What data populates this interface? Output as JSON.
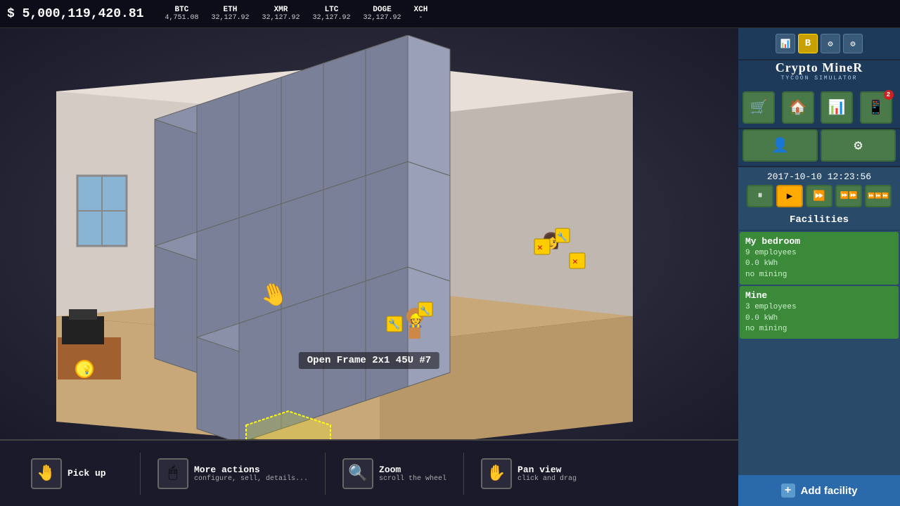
{
  "top_bar": {
    "balance": "$ 5,000,119,420.81",
    "cryptos": [
      {
        "name": "BTC",
        "value": "4,751.08"
      },
      {
        "name": "ETH",
        "value": "32,127.92"
      },
      {
        "name": "XMR",
        "value": "32,127.92"
      },
      {
        "name": "LTC",
        "value": "32,127.92"
      },
      {
        "name": "DOGE",
        "value": "32,127.92"
      },
      {
        "name": "XCH",
        "value": "-"
      }
    ]
  },
  "logo": {
    "title": "Crypto MineR",
    "subtitle": "TYCOON SIMULATOR"
  },
  "datetime": "2017-10-10 12:23:56",
  "speed_controls": [
    {
      "label": "⏸",
      "id": "pause",
      "active": false
    },
    {
      "label": "▶",
      "id": "play",
      "active": true
    },
    {
      "label": "⏩",
      "id": "fast",
      "active": false
    },
    {
      "label": "⏩⏩",
      "id": "faster",
      "active": false
    },
    {
      "label": "⏩⏩⏩",
      "id": "fastest",
      "active": false
    }
  ],
  "facilities_header": "Facilities",
  "facilities": [
    {
      "name": "My bedroom",
      "employees": "9 employees",
      "power": "0.0 kWh",
      "mining": "no mining"
    },
    {
      "name": "Mine",
      "employees": "3 employees",
      "power": "0.0 kWh",
      "mining": "no mining"
    }
  ],
  "add_facility_label": "Add facility",
  "selected_item": "Open Frame 2x1 45U #7",
  "hud_actions": [
    {
      "id": "pickup",
      "name": "Pick up",
      "desc": "",
      "icon": "🤚"
    },
    {
      "id": "more_actions",
      "name": "More actions",
      "desc": "configure, sell, details...",
      "icon": "🖱"
    },
    {
      "id": "zoom",
      "name": "Zoom",
      "desc": "scroll the wheel",
      "icon": "🔍"
    },
    {
      "id": "pan_view",
      "name": "Pan view",
      "desc": "click and drag",
      "icon": "✋"
    }
  ],
  "nav_buttons": [
    {
      "id": "shop",
      "icon": "🛒",
      "badge": null
    },
    {
      "id": "warehouse",
      "icon": "🏠",
      "badge": null
    },
    {
      "id": "stats",
      "icon": "📊",
      "badge": null
    },
    {
      "id": "mobile",
      "icon": "📱",
      "badge": "2"
    }
  ],
  "nav_row2": [
    {
      "id": "people",
      "icon": "👤",
      "badge": null
    },
    {
      "id": "settings",
      "icon": "⚙",
      "badge": null
    }
  ],
  "colors": {
    "facility_bg": "#3a8a3a",
    "add_facility_bg": "#2a6aaa",
    "nav_btn_bg": "#4a7a4a",
    "active_speed": "#ffaa00"
  }
}
